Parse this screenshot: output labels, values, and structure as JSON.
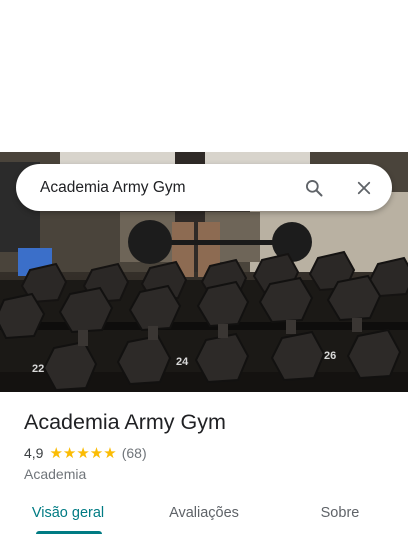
{
  "search": {
    "query": "Academia Army Gym",
    "search_icon": "search-icon",
    "close_icon": "close-icon"
  },
  "hero": {
    "plate_labels": [
      "24",
      "26",
      "22"
    ]
  },
  "place": {
    "name": "Academia Army Gym",
    "rating": "4,9",
    "stars": "★★★★★",
    "star_value": 4.9,
    "review_count": "(68)",
    "category": "Academia"
  },
  "tabs": [
    {
      "label": "Visão geral",
      "active": true
    },
    {
      "label": "Avaliações",
      "active": false
    },
    {
      "label": "Sobre",
      "active": false
    }
  ],
  "colors": {
    "accent": "#007b83",
    "star": "#fbbc04",
    "text": "#202124",
    "muted": "#70757a"
  }
}
